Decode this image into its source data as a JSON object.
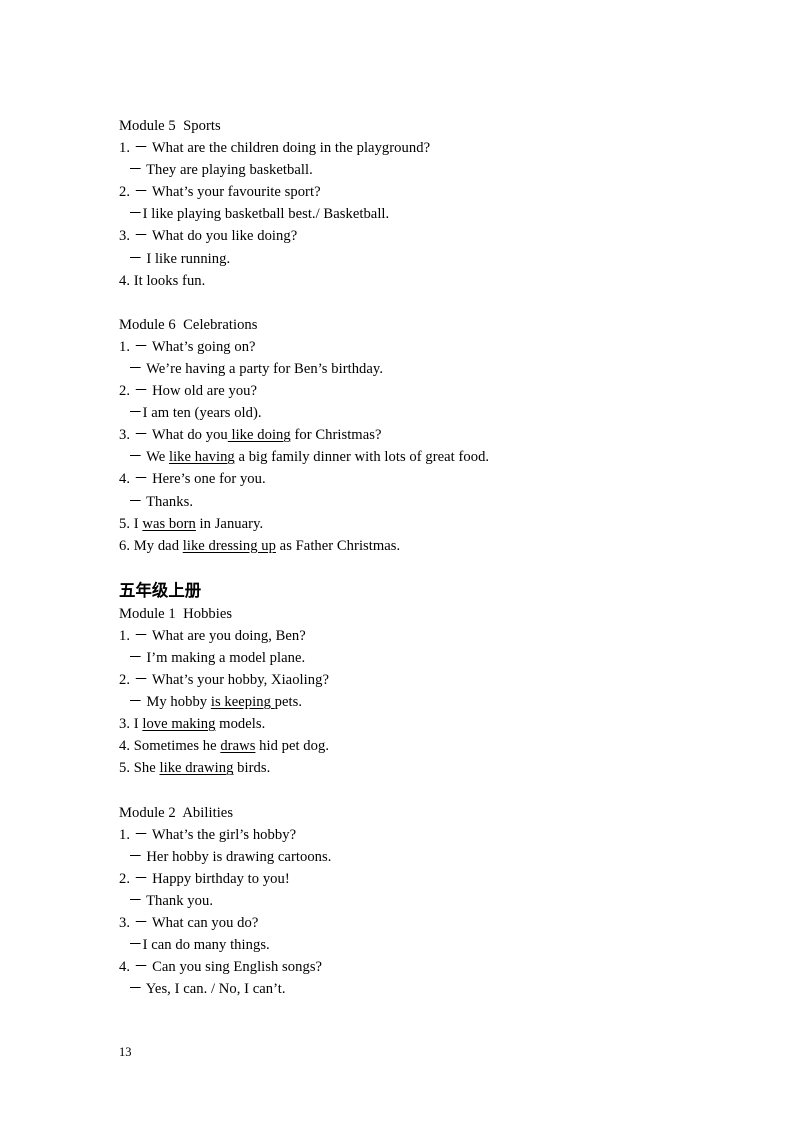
{
  "document": {
    "page_number": "13",
    "background_color": "#ffffff",
    "text_color": "#000000"
  },
  "sections": [
    {
      "heading": "Module 5  Sports",
      "lines": [
        {
          "kind": "q",
          "text": "1. － What are the children doing in the playground?"
        },
        {
          "kind": "a",
          "text": "－ They are playing basketball."
        },
        {
          "kind": "q",
          "text": "2. － What’s your favourite sport?"
        },
        {
          "kind": "a",
          "text": "－I like playing basketball best./ Basketball."
        },
        {
          "kind": "q",
          "text": "3. － What do you like doing?"
        },
        {
          "kind": "a",
          "text": "－ I like running."
        },
        {
          "kind": "q",
          "text": "4. It looks fun."
        }
      ]
    },
    {
      "heading": "Module 6  Celebrations",
      "lines": [
        {
          "kind": "q",
          "text": "1. － What’s going on?"
        },
        {
          "kind": "a",
          "text": "－ We’re having a party for Ben’s birthday."
        },
        {
          "kind": "q",
          "text": "2. － How old are you?"
        },
        {
          "kind": "a",
          "text": "－I am ten (years old)."
        },
        {
          "kind": "q",
          "html": "3. － What do you<u> like doing</u> for Christmas?"
        },
        {
          "kind": "a",
          "html": "－ We <u>like having</u> a big family dinner with lots of great food."
        },
        {
          "kind": "q",
          "text": "4. － Here’s one for you."
        },
        {
          "kind": "a",
          "text": "－ Thanks."
        },
        {
          "kind": "q",
          "html": "5. I <u>was born</u> in January."
        },
        {
          "kind": "q",
          "html": "6. My dad <u>like dressing up</u> as Father Christmas."
        }
      ]
    },
    {
      "cn_heading": "五年级上册",
      "heading": "Module 1  Hobbies",
      "lines": [
        {
          "kind": "q",
          "text": "1. － What are you doing, Ben?"
        },
        {
          "kind": "a",
          "text": "－ I’m making a model plane."
        },
        {
          "kind": "q",
          "text": "2. － What’s your hobby, Xiaoling?"
        },
        {
          "kind": "a",
          "html": "－ My hobby <u>is keeping </u>pets."
        },
        {
          "kind": "q",
          "html": "3. I <u>love making</u> models."
        },
        {
          "kind": "q",
          "html": "4. Sometimes he <u>draws</u> hid pet dog."
        },
        {
          "kind": "q",
          "html": "5. She <u>like drawing</u> birds."
        }
      ]
    },
    {
      "heading": "Module 2  Abilities",
      "lines": [
        {
          "kind": "q",
          "text": "1. － What’s the girl’s hobby?"
        },
        {
          "kind": "a",
          "text": "－ Her hobby is drawing cartoons."
        },
        {
          "kind": "q",
          "text": "2. － Happy birthday to you!"
        },
        {
          "kind": "a",
          "text": "－ Thank you."
        },
        {
          "kind": "q",
          "text": "3. － What can you do?"
        },
        {
          "kind": "a",
          "text": "－I can do many things."
        },
        {
          "kind": "q",
          "text": "4. － Can you sing English songs?"
        },
        {
          "kind": "a",
          "text": "－ Yes, I can. / No, I can’t."
        }
      ]
    }
  ]
}
